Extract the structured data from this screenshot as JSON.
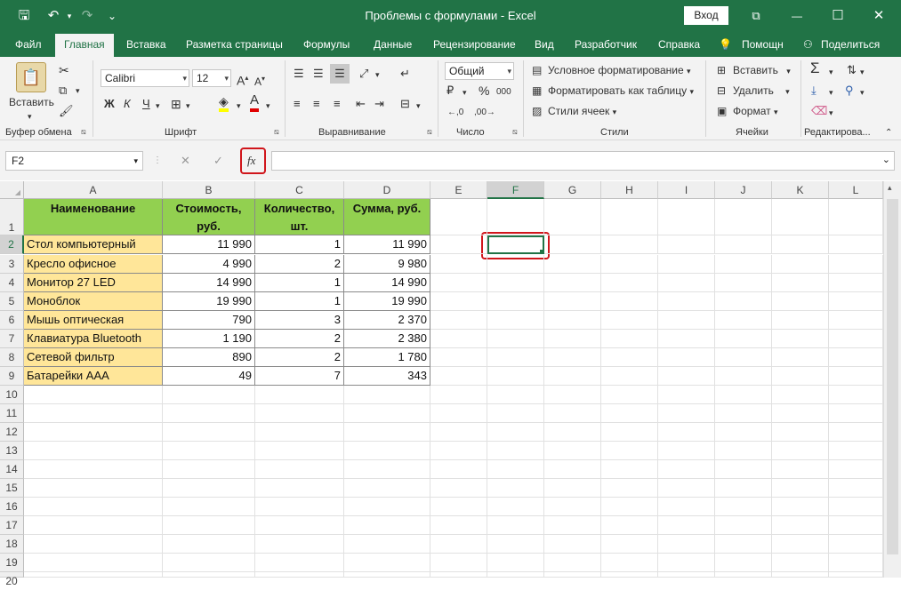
{
  "window": {
    "title": "Проблемы с формулами - Excel",
    "login": "Вход",
    "quick_access": {
      "save": "🖫",
      "undo": "↶",
      "redo": "↷",
      "customize": "⌄"
    },
    "controls": {
      "ribbon_display": "⧉",
      "minimize": "—",
      "maximize": "☐",
      "close": "✕"
    }
  },
  "tabs": [
    "Файл",
    "Главная",
    "Вставка",
    "Разметка страницы",
    "Формулы",
    "Данные",
    "Рецензирование",
    "Вид",
    "Разработчик",
    "Справка",
    "Помощн",
    "Поделиться"
  ],
  "ribbon": {
    "clipboard": {
      "paste": "Вставить",
      "label": "Буфер обмена"
    },
    "font": {
      "name": "Calibri",
      "size": "12",
      "bold": "Ж",
      "italic": "К",
      "underline": "Ч",
      "label": "Шрифт"
    },
    "alignment": {
      "label": "Выравнивание"
    },
    "number": {
      "format": "Общий",
      "percent": "%",
      "comma": "000",
      "label": "Число"
    },
    "styles": {
      "conditional": "Условное форматирование",
      "table": "Форматировать как таблицу",
      "cell_styles": "Стили ячеек",
      "label": "Стили"
    },
    "cells": {
      "insert": "Вставить",
      "delete": "Удалить",
      "format": "Формат",
      "label": "Ячейки"
    },
    "editing": {
      "label": "Редактирова..."
    }
  },
  "formula_bar": {
    "name_box": "F2",
    "cancel": "✕",
    "enter": "✓",
    "fx": "fx",
    "value": ""
  },
  "columns": [
    "A",
    "B",
    "C",
    "D",
    "E",
    "F",
    "G",
    "H",
    "I",
    "J",
    "K",
    "L"
  ],
  "rows": [
    "1",
    "2",
    "3",
    "4",
    "5",
    "6",
    "7",
    "8",
    "9",
    "10",
    "11",
    "12",
    "13",
    "14",
    "15",
    "16",
    "17",
    "18",
    "19",
    "20"
  ],
  "table": {
    "headers": [
      "Наименование",
      "Стоимость, руб.",
      "Количество, шт.",
      "Сумма, руб."
    ],
    "rows": [
      [
        "Стол компьютерный",
        "11 990",
        "1",
        "11 990"
      ],
      [
        "Кресло офисное",
        "4 990",
        "2",
        "9 980"
      ],
      [
        "Монитор 27 LED",
        "14 990",
        "1",
        "14 990"
      ],
      [
        "Моноблок",
        "19 990",
        "1",
        "19 990"
      ],
      [
        "Мышь оптическая",
        "790",
        "3",
        "2 370"
      ],
      [
        "Клавиатура Bluetooth",
        "1 190",
        "2",
        "2 380"
      ],
      [
        "Сетевой фильтр",
        "890",
        "2",
        "1 780"
      ],
      [
        "Батарейки AAA",
        "49",
        "7",
        "343"
      ]
    ]
  },
  "colors": {
    "excel_green": "#217346",
    "header_fill": "#92d050",
    "name_fill": "#ffe699",
    "highlight": "#d0161c"
  }
}
